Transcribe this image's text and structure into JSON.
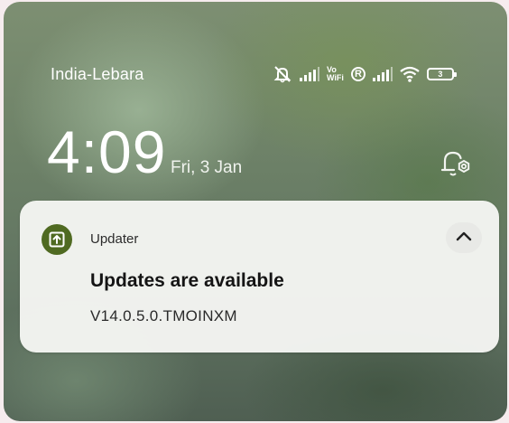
{
  "status_bar": {
    "carrier": "India-Lebara",
    "vowifi_top": "Vo",
    "vowifi_bottom": "WiFi",
    "roaming_badge": "R",
    "battery_level": "3",
    "icons": [
      "mute-icon",
      "signal-icon",
      "vowifi-icon",
      "roaming-icon",
      "signal-icon",
      "wifi-icon",
      "battery-icon"
    ]
  },
  "lockscreen": {
    "time": "4:09",
    "date": "Fri, 3 Jan",
    "settings_icon": "notification-settings-icon"
  },
  "notification": {
    "app_name": "Updater",
    "app_icon": "update-arrow-icon",
    "title": "Updates are available",
    "body": "V14.0.5.0.TMOINXM",
    "collapse_icon": "chevron-up-icon",
    "app_icon_color": "#4f6a21"
  }
}
